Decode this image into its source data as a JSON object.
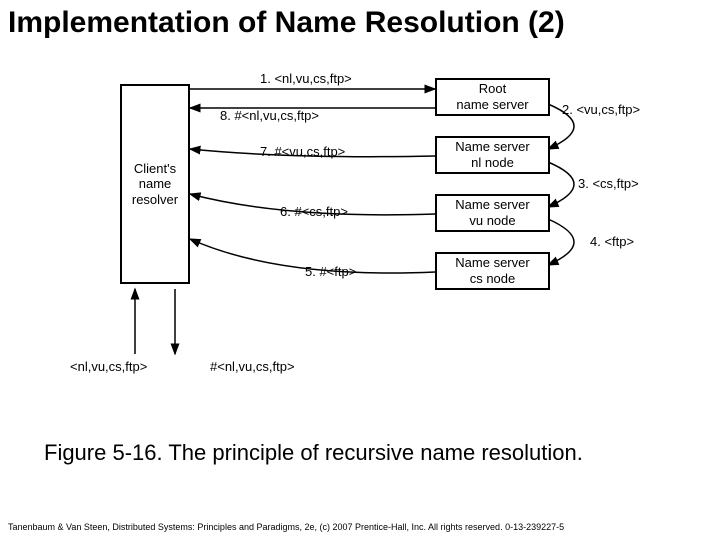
{
  "title": "Implementation of Name Resolution (2)",
  "boxes": {
    "client": "Client's\nname\nresolver",
    "root": "Root\nname server",
    "nl": "Name server\nnl node",
    "vu": "Name server\nvu node",
    "cs": "Name server\ncs node"
  },
  "edges": {
    "e1": "1. <nl,vu,cs,ftp>",
    "e2": "2. <vu,cs,ftp>",
    "e3": "3. <cs,ftp>",
    "e4": "4. <ftp>",
    "e5": "5. #<ftp>",
    "e6": "6. #<cs,ftp>",
    "e7": "7. #<vu,cs,ftp>",
    "e8": "8. #<nl,vu,cs,ftp>",
    "in": "<nl,vu,cs,ftp>",
    "out": "#<nl,vu,cs,ftp>"
  },
  "caption": "Figure 5-16. The principle of recursive name resolution.",
  "footer": "Tanenbaum & Van Steen, Distributed Systems: Principles and Paradigms, 2e, (c) 2007 Prentice-Hall, Inc. All rights reserved. 0-13-239227-5"
}
